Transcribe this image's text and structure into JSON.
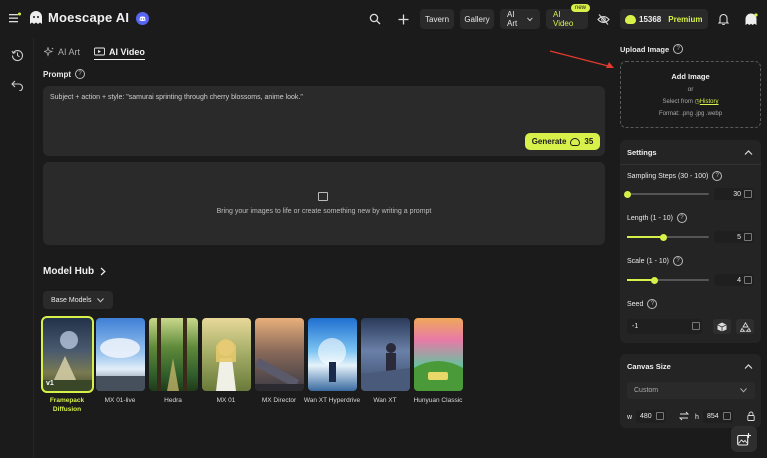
{
  "header": {
    "brand": "Moescape AI",
    "nav": {
      "tavern": "Tavern",
      "gallery": "Gallery",
      "ai_art": "AI Art",
      "ai_video": "AI Video",
      "new_badge": "new"
    },
    "credits": "15368",
    "premium": "Premium"
  },
  "tabs": [
    {
      "label": "AI Art",
      "active": false
    },
    {
      "label": "AI Video",
      "active": true
    }
  ],
  "prompt": {
    "label": "Prompt",
    "text": "Subject + action + style: \"samurai sprinting through cherry blossoms, anime look.\"",
    "generate_label": "Generate",
    "generate_cost": "35"
  },
  "preview": {
    "text": "Bring your images to life or create something new by writing a prompt"
  },
  "model_hub": {
    "title": "Model Hub",
    "filter": "Base Models",
    "models": [
      {
        "name": "Framepack Diffusion",
        "selected": true,
        "badge": "v1"
      },
      {
        "name": "MX 01-live",
        "selected": false
      },
      {
        "name": "Hedra",
        "selected": false
      },
      {
        "name": "MX 01",
        "selected": false
      },
      {
        "name": "MX Director",
        "selected": false
      },
      {
        "name": "Wan XT Hyperdrive",
        "selected": false
      },
      {
        "name": "Wan XT",
        "selected": false
      },
      {
        "name": "Hunyuan Classic",
        "selected": false
      }
    ]
  },
  "upload": {
    "label": "Upload Image",
    "title": "Add Image",
    "or": "or",
    "select_from": "Select from",
    "history": "History",
    "format": "Format: .png .jpg .webp"
  },
  "settings": {
    "title": "Settings",
    "sampling": {
      "label": "Sampling Steps (30 - 100)",
      "value": "30",
      "fraction": 0.0
    },
    "length": {
      "label": "Length (1 - 10)",
      "value": "5",
      "fraction": 0.44
    },
    "scale": {
      "label": "Scale (1 - 10)",
      "value": "4",
      "fraction": 0.33
    },
    "seed": {
      "label": "Seed",
      "value": "-1"
    }
  },
  "canvas": {
    "title": "Canvas Size",
    "preset": "Custom",
    "w_label": "w",
    "w_value": "480",
    "h_label": "h",
    "h_value": "854"
  },
  "colors": {
    "accent": "#d8f04a",
    "background": "#1b1b1b",
    "panel": "#242424",
    "field": "#2a2a2a",
    "arrow": "#e23b2e"
  }
}
